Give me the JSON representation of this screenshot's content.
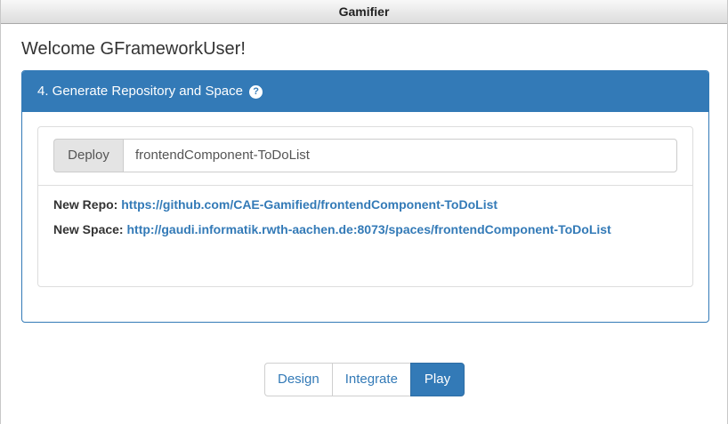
{
  "window": {
    "title": "Gamifier"
  },
  "welcome": "Welcome GFrameworkUser!",
  "panel": {
    "heading": "4. Generate Repository and Space",
    "help_icon": "question-circle-icon",
    "help_glyph": "?"
  },
  "deploy": {
    "label": "Deploy",
    "value": "frontendComponent-ToDoList"
  },
  "repo": {
    "label": "New Repo:",
    "url": "https://github.com/CAE-Gamified/frontendComponent-ToDoList"
  },
  "space": {
    "label": "New Space:",
    "url": "http://gaudi.informatik.rwth-aachen.de:8073/spaces/frontendComponent-ToDoList"
  },
  "tabs": [
    {
      "label": "Design",
      "active": false
    },
    {
      "label": "Integrate",
      "active": false
    },
    {
      "label": "Play",
      "active": true
    }
  ],
  "colors": {
    "primary": "#337ab7",
    "title_bar": "#dcdcdc"
  }
}
